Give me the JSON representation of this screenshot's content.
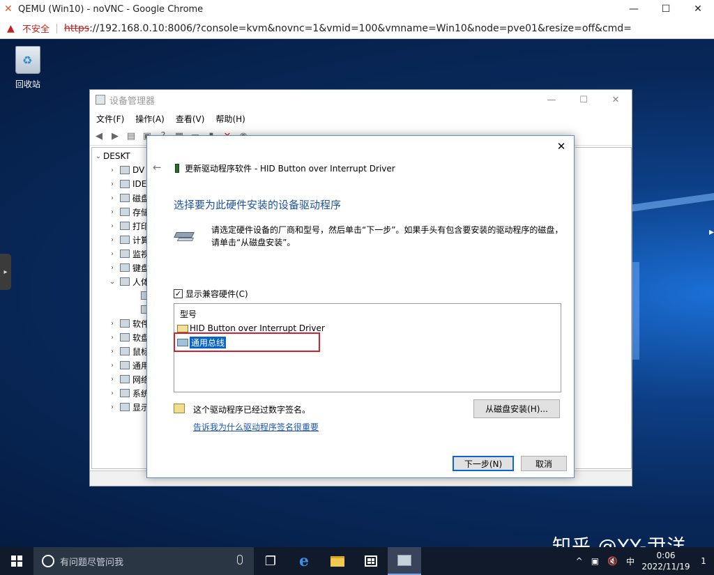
{
  "browser": {
    "title": "QEMU (Win10) - noVNC - Google Chrome",
    "insecure_label": "不安全",
    "url_scheme": "https",
    "url_rest": "://192.168.0.10:8006/?console=kvm&novnc=1&vmid=100&vmname=Win10&node=pve01&resize=off&cmd=",
    "minimize": "—",
    "maximize": "☐",
    "close": "✕"
  },
  "desktop": {
    "recycle_bin_label": "回收站"
  },
  "device_manager": {
    "title": "设备管理器",
    "menu": [
      "文件(F)",
      "操作(A)",
      "查看(V)",
      "帮助(H)"
    ],
    "toolbar_icons": [
      "back-arrow-icon",
      "forward-arrow-icon",
      "properties-icon",
      "computer-icon",
      "help-icon",
      "view-icon",
      "monitor-icon",
      "update-driver-icon",
      "uninstall-icon",
      "scan-icon"
    ],
    "tree": [
      {
        "label": "DESKT",
        "expand": "⌄",
        "level": 0
      },
      {
        "label": "DV",
        "expand": "›",
        "level": 1
      },
      {
        "label": "IDE",
        "expand": "›",
        "level": 1
      },
      {
        "label": "磁盘",
        "expand": "›",
        "level": 1
      },
      {
        "label": "存储",
        "expand": "›",
        "level": 1
      },
      {
        "label": "打印",
        "expand": "›",
        "level": 1
      },
      {
        "label": "计算",
        "expand": "›",
        "level": 1
      },
      {
        "label": "监视",
        "expand": "›",
        "level": 1
      },
      {
        "label": "键盘",
        "expand": "›",
        "level": 1
      },
      {
        "label": "人体",
        "expand": "⌄",
        "level": 1
      },
      {
        "label": "",
        "expand": "",
        "level": 2
      },
      {
        "label": "",
        "expand": "",
        "level": 2
      },
      {
        "label": "软件",
        "expand": "›",
        "level": 1
      },
      {
        "label": "软盘",
        "expand": "›",
        "level": 1
      },
      {
        "label": "鼠标",
        "expand": "›",
        "level": 1
      },
      {
        "label": "通用",
        "expand": "›",
        "level": 1
      },
      {
        "label": "网络",
        "expand": "›",
        "level": 1
      },
      {
        "label": "系统",
        "expand": "›",
        "level": 1
      },
      {
        "label": "显示",
        "expand": "›",
        "level": 1
      }
    ]
  },
  "wizard": {
    "header": "更新驱动程序软件 - HID Button over Interrupt Driver",
    "heading": "选择要为此硬件安装的设备驱动程序",
    "description": "请选定硬件设备的厂商和型号，然后单击“下一步”。如果手头有包含要安装的驱动程序的磁盘，请单击“从磁盘安装”。",
    "show_compatible_label": "显示兼容硬件(C)",
    "show_compatible_checked": true,
    "list_header": "型号",
    "models": [
      {
        "label": "HID Button over Interrupt Driver",
        "selected": false
      },
      {
        "label": "通用总线",
        "selected": true
      }
    ],
    "signed_text": "这个驱动程序已经过数字签名。",
    "signing_link": "告诉我为什么驱动程序签名很重要",
    "have_disk_button": "从磁盘安装(H)...",
    "next_button": "下一步(N)",
    "cancel_button": "取消",
    "close": "✕",
    "back": "←"
  },
  "taskbar": {
    "search_placeholder": "有问题尽管问我",
    "time": "0:06",
    "date": "2022/11/19",
    "ime": "中",
    "notification_count": "1"
  },
  "watermark": "知乎 @YY-尹洋",
  "colors": {
    "heading_blue": "#1d53a4",
    "link_blue": "#1a55b5",
    "highlight": "#0a64c8",
    "annotation_red": "#d4202a",
    "insecure_red": "#c5221f"
  }
}
